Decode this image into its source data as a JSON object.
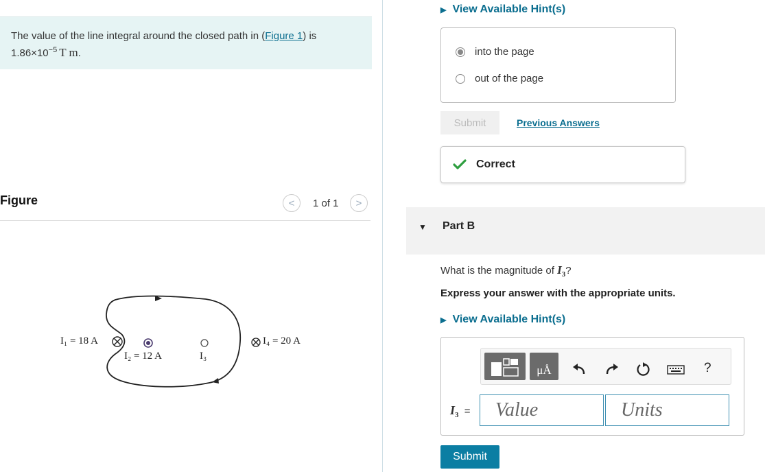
{
  "problem": {
    "statement_prefix": "The value of the line integral around the closed path in (",
    "figure_link": "Figure 1",
    "statement_suffix": ") is",
    "value_mantissa": "1.86×10",
    "value_exponent": "−5",
    "value_units": "T m",
    "value_end": "."
  },
  "figure": {
    "title": "Figure",
    "pager": "1 of 1",
    "prev_glyph": "<",
    "next_glyph": ">",
    "labels": {
      "i1": "I₁ = 18 A",
      "i2": "I₂ = 12 A",
      "i3": "I₃",
      "i4": "I₄ = 20 A"
    }
  },
  "part_a": {
    "hints_label": "View Available Hint(s)",
    "choices": [
      {
        "label": "into the page",
        "selected": true
      },
      {
        "label": "out of the page",
        "selected": false
      }
    ],
    "submit_label": "Submit",
    "previous_answers_label": "Previous Answers",
    "feedback": "Correct",
    "feedback_icon": "check-icon"
  },
  "part_b": {
    "title": "Part B",
    "question_prefix": "What is the magnitude of ",
    "question_var": "I",
    "question_sub": "3",
    "question_suffix": "?",
    "instruction": "Express your answer with the appropriate units.",
    "hints_label": "View Available Hint(s)",
    "toolbar": {
      "units_tool_label": "μÅ",
      "help_label": "?",
      "icons": [
        "templates-icon",
        "units-icon",
        "undo-icon",
        "redo-icon",
        "reset-icon",
        "keyboard-icon",
        "help-icon"
      ]
    },
    "answer_var": "I",
    "answer_sub": "3",
    "answer_eq": "=",
    "value_placeholder": "Value",
    "units_placeholder": "Units",
    "submit_label": "Submit"
  },
  "colors": {
    "accent": "#0b7ea3",
    "link": "#0b6e8f",
    "hint_background": "#e6f4f4",
    "correct_check": "#2e9e3f"
  }
}
